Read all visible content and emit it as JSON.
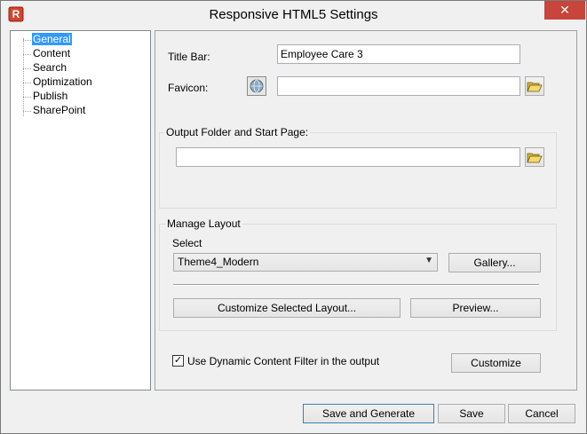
{
  "window": {
    "title": "Responsive HTML5 Settings",
    "close_label": "✕"
  },
  "tree": {
    "items": [
      {
        "label": "General",
        "selected": true
      },
      {
        "label": "Content"
      },
      {
        "label": "Search"
      },
      {
        "label": "Optimization"
      },
      {
        "label": "Publish"
      },
      {
        "label": "SharePoint"
      }
    ]
  },
  "general": {
    "title_bar_label": "Title Bar:",
    "title_bar_value": "Employee Care 3",
    "favicon_label": "Favicon:",
    "favicon_value": "",
    "output_group_title": "Output Folder and Start Page:",
    "output_value": "",
    "layout_group_title": "Manage Layout",
    "select_label": "Select",
    "layout_selected": "Theme4_Modern",
    "gallery_button": "Gallery...",
    "customize_layout_button": "Customize Selected Layout...",
    "preview_button": "Preview...",
    "dynamic_filter_label": "Use Dynamic Content Filter in the output",
    "dynamic_filter_checked": true,
    "customize_button": "Customize"
  },
  "footer": {
    "save_generate_button": "Save and Generate",
    "save_button": "Save",
    "cancel_button": "Cancel"
  },
  "icons": {
    "app": "robohelp-app-icon",
    "favicon": "globe-icon",
    "folder": "open-folder-icon",
    "check": "check-icon"
  }
}
